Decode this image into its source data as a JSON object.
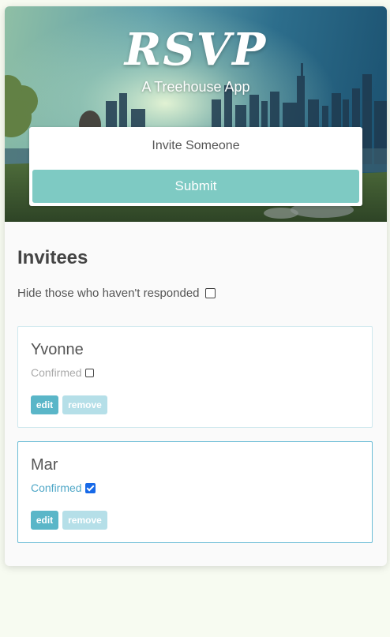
{
  "header": {
    "title": "RSVP",
    "subtitle": "A Treehouse App"
  },
  "invite_form": {
    "placeholder": "Invite Someone",
    "submit_label": "Submit"
  },
  "main": {
    "heading": "Invitees",
    "filter_label": "Hide those who haven't responded",
    "filter_checked": false
  },
  "invitees": [
    {
      "name": "Yvonne",
      "confirm_label": "Confirmed",
      "confirmed": false,
      "edit_label": "edit",
      "remove_label": "remove"
    },
    {
      "name": "Mar",
      "confirm_label": "Confirmed",
      "confirmed": true,
      "edit_label": "edit",
      "remove_label": "remove"
    }
  ],
  "colors": {
    "accent": "#7ecac3",
    "edit_button": "#5ab6c8",
    "remove_button": "#b5dfe8",
    "confirmed_text": "#4fa7c7",
    "page_background": "#f7fbf1"
  }
}
